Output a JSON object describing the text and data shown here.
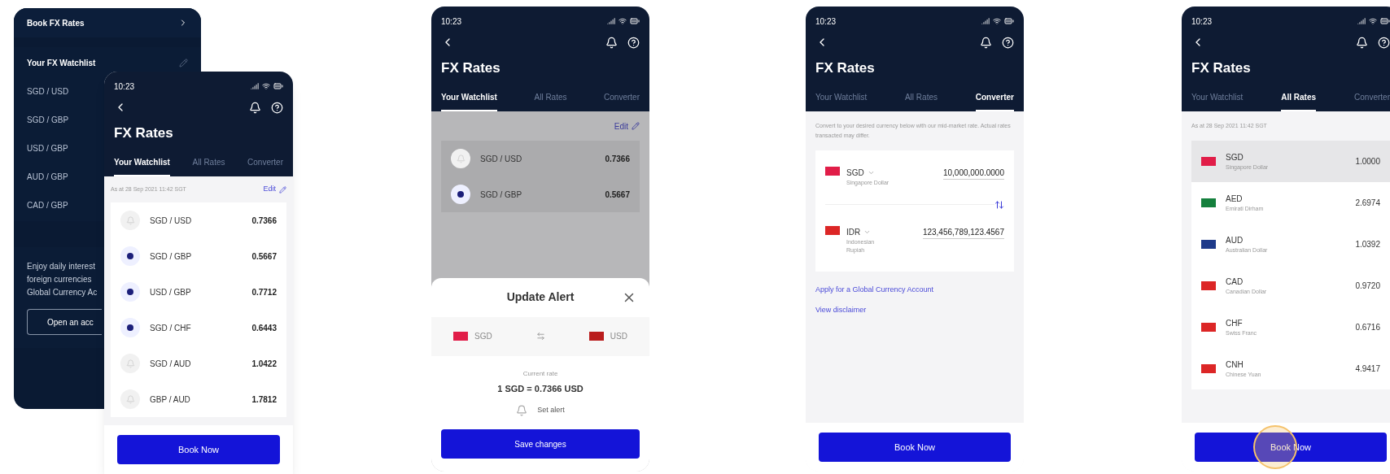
{
  "background_screen": {
    "menu_item": "Book FX Rates",
    "watchlist_title": "Your FX Watchlist",
    "pairs": [
      "SGD / USD",
      "SGD / GBP",
      "USD / GBP",
      "AUD / GBP",
      "CAD / GBP"
    ],
    "promo_lines": [
      "Enjoy daily interest",
      "foreign currencies",
      "Global Currency Ac"
    ],
    "promo_button": "Open an acc"
  },
  "watchlist_screen": {
    "header": {
      "time": "10:23",
      "title": "FX Rates",
      "tabs": [
        {
          "label": "Your Watchlist",
          "selected": true
        },
        {
          "label": "All Rates",
          "selected": false
        },
        {
          "label": "Converter",
          "selected": false
        }
      ]
    },
    "as_at": "As at 28 Sep 2021 11:42 SGT",
    "edit": "Edit",
    "rows": [
      {
        "pair": "SGD / USD",
        "rate": "0.7366",
        "alert": false
      },
      {
        "pair": "SGD / GBP",
        "rate": "0.5667",
        "alert": true
      },
      {
        "pair": "USD / GBP",
        "rate": "0.7712",
        "alert": true
      },
      {
        "pair": "SGD / CHF",
        "rate": "0.6443",
        "alert": true
      },
      {
        "pair": "SGD / AUD",
        "rate": "1.0422",
        "alert": false
      },
      {
        "pair": "GBP / AUD",
        "rate": "1.7812",
        "alert": false
      }
    ],
    "button": "Book Now"
  },
  "alert_screen": {
    "header": {
      "time": "10:23",
      "title": "FX Rates",
      "tabs": [
        {
          "label": "Your Watchlist",
          "selected": true
        },
        {
          "label": "All Rates",
          "selected": false
        },
        {
          "label": "Converter",
          "selected": false
        }
      ]
    },
    "edit": "Edit",
    "rows": [
      {
        "pair": "SGD / USD",
        "rate": "0.7366",
        "alert": false
      },
      {
        "pair": "SGD / GBP",
        "rate": "0.5667",
        "alert": true
      }
    ],
    "sheet": {
      "title": "Update Alert",
      "from": {
        "code": "SGD",
        "color": "#e11d48"
      },
      "to": {
        "code": "USD",
        "color": "#b91c1c"
      },
      "rate_label": "Current rate",
      "rate": "1 SGD = 0.7366 USD",
      "set_alert": "Set alert",
      "button": "Save changes"
    }
  },
  "converter_screen": {
    "header": {
      "time": "10:23",
      "title": "FX Rates",
      "tabs": [
        {
          "label": "Your Watchlist",
          "selected": false
        },
        {
          "label": "All Rates",
          "selected": false
        },
        {
          "label": "Converter",
          "selected": true
        }
      ]
    },
    "intro": "Convert to your desired currency below with our mid-market rate. Actual rates transacted may differ.",
    "currencies": [
      {
        "code": "SGD",
        "name": "Singapore Dollar",
        "amount": "10,000,000.0000",
        "color": "#e11d48"
      },
      {
        "code": "IDR",
        "name": "Indonesian Rupiah",
        "amount": "123,456,789,123.4567",
        "color": "#dc2626"
      }
    ],
    "links": [
      "Apply for a Global Currency Account",
      "View disclaimer"
    ],
    "button": "Book Now"
  },
  "all_rates_screen": {
    "header": {
      "time": "10:23",
      "title": "FX Rates",
      "tabs": [
        {
          "label": "Your Watchlist",
          "selected": false
        },
        {
          "label": "All Rates",
          "selected": true
        },
        {
          "label": "Converter",
          "selected": false
        }
      ]
    },
    "as_at": "As at 28 Sep 2021 11:42 SGT",
    "rows": [
      {
        "code": "SGD",
        "name": "Singapore Dollar",
        "rate": "1.0000",
        "color": "#e11d48",
        "selected": true
      },
      {
        "code": "AED",
        "name": "Emirati Dirham",
        "rate": "2.6974",
        "color": "#15803d",
        "selected": false
      },
      {
        "code": "AUD",
        "name": "Australian Dollar",
        "rate": "1.0392",
        "color": "#1e3a8a",
        "selected": false
      },
      {
        "code": "CAD",
        "name": "Canadian Dollar",
        "rate": "0.9720",
        "color": "#dc2626",
        "selected": false
      },
      {
        "code": "CHF",
        "name": "Swiss Franc",
        "rate": "0.6716",
        "color": "#dc2626",
        "selected": false
      },
      {
        "code": "CNH",
        "name": "Chinese Yuan",
        "rate": "4.9417",
        "color": "#dc2626",
        "selected": false
      }
    ],
    "button": "Book Now",
    "tap_highlight": true
  }
}
